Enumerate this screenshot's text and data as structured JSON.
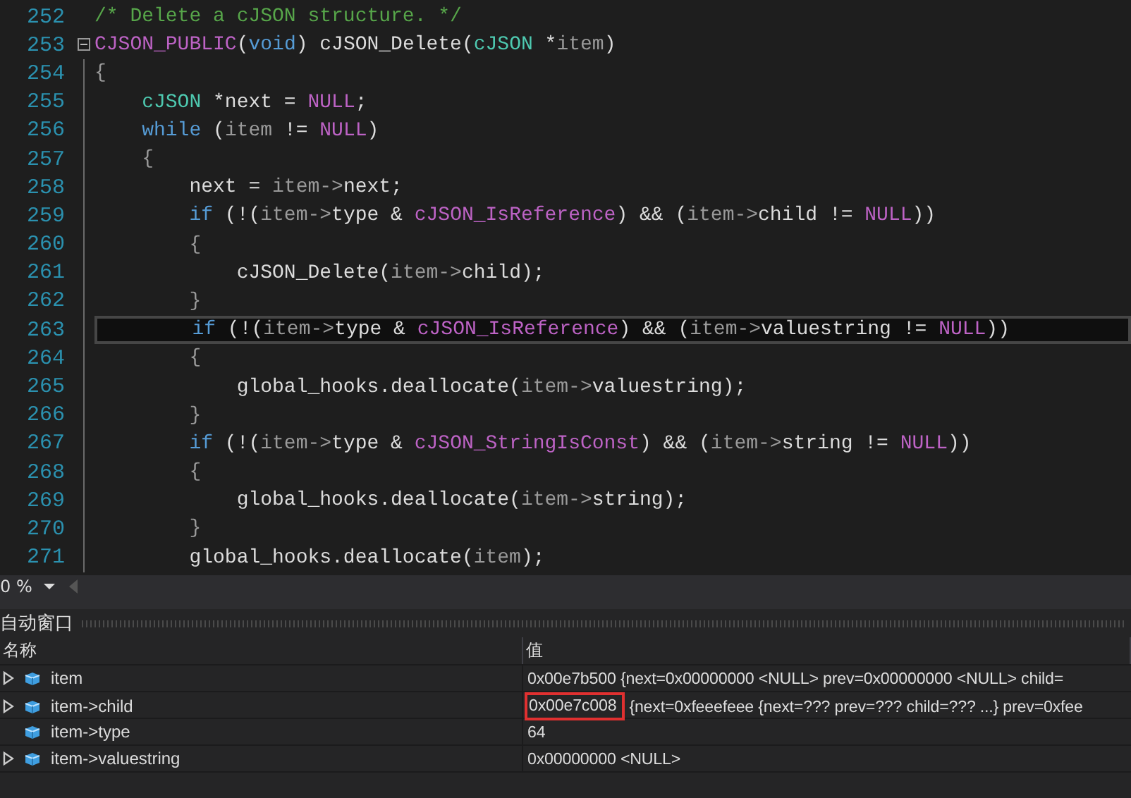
{
  "editor": {
    "lines": [
      {
        "number": "252",
        "current": false,
        "fold": false,
        "tokens": [
          {
            "kind": "comment",
            "text": "/* Delete a cJSON structure. */"
          }
        ]
      },
      {
        "number": "253",
        "current": false,
        "fold": true,
        "tokens": [
          {
            "kind": "macro",
            "text": "CJSON_PUBLIC"
          },
          {
            "kind": "plain",
            "text": "("
          },
          {
            "kind": "keyword",
            "text": "void"
          },
          {
            "kind": "plain",
            "text": ") cJSON_Delete("
          },
          {
            "kind": "type",
            "text": "cJSON"
          },
          {
            "kind": "plain",
            "text": " *"
          },
          {
            "kind": "param",
            "text": "item"
          },
          {
            "kind": "plain",
            "text": ")"
          }
        ]
      },
      {
        "number": "254",
        "current": false,
        "fold": false,
        "tokens": [
          {
            "kind": "punct",
            "text": "{"
          }
        ]
      },
      {
        "number": "255",
        "current": false,
        "fold": false,
        "tokens": [
          {
            "kind": "type",
            "text": "    cJSON"
          },
          {
            "kind": "plain",
            "text": " *next = "
          },
          {
            "kind": "macro",
            "text": "NULL"
          },
          {
            "kind": "plain",
            "text": ";"
          }
        ]
      },
      {
        "number": "256",
        "current": false,
        "fold": false,
        "tokens": [
          {
            "kind": "keyword",
            "text": "    while"
          },
          {
            "kind": "plain",
            "text": " ("
          },
          {
            "kind": "param",
            "text": "item"
          },
          {
            "kind": "plain",
            "text": " != "
          },
          {
            "kind": "macro",
            "text": "NULL"
          },
          {
            "kind": "plain",
            "text": ")"
          }
        ]
      },
      {
        "number": "257",
        "current": false,
        "fold": false,
        "tokens": [
          {
            "kind": "punct",
            "text": "    {"
          }
        ]
      },
      {
        "number": "258",
        "current": false,
        "fold": false,
        "tokens": [
          {
            "kind": "plain",
            "text": "        next = "
          },
          {
            "kind": "param",
            "text": "item->"
          },
          {
            "kind": "plain",
            "text": "next;"
          }
        ]
      },
      {
        "number": "259",
        "current": false,
        "fold": false,
        "tokens": [
          {
            "kind": "keyword",
            "text": "        if"
          },
          {
            "kind": "plain",
            "text": " (!("
          },
          {
            "kind": "param",
            "text": "item->"
          },
          {
            "kind": "plain",
            "text": "type & "
          },
          {
            "kind": "macro",
            "text": "cJSON_IsReference"
          },
          {
            "kind": "plain",
            "text": ") && ("
          },
          {
            "kind": "param",
            "text": "item->"
          },
          {
            "kind": "plain",
            "text": "child != "
          },
          {
            "kind": "macro",
            "text": "NULL"
          },
          {
            "kind": "plain",
            "text": "))"
          }
        ]
      },
      {
        "number": "260",
        "current": false,
        "fold": false,
        "tokens": [
          {
            "kind": "punct",
            "text": "        {"
          }
        ]
      },
      {
        "number": "261",
        "current": false,
        "fold": false,
        "tokens": [
          {
            "kind": "plain",
            "text": "            cJSON_Delete("
          },
          {
            "kind": "param",
            "text": "item->"
          },
          {
            "kind": "plain",
            "text": "child);"
          }
        ]
      },
      {
        "number": "262",
        "current": false,
        "fold": false,
        "tokens": [
          {
            "kind": "punct",
            "text": "        }"
          }
        ]
      },
      {
        "number": "263",
        "current": true,
        "fold": false,
        "tokens": [
          {
            "kind": "keyword",
            "text": "        if"
          },
          {
            "kind": "plain",
            "text": " (!("
          },
          {
            "kind": "param",
            "text": "item->"
          },
          {
            "kind": "plain",
            "text": "type & "
          },
          {
            "kind": "macro",
            "text": "cJSON_IsReference"
          },
          {
            "kind": "plain",
            "text": ") && ("
          },
          {
            "kind": "param",
            "text": "item->"
          },
          {
            "kind": "plain",
            "text": "valuestring != "
          },
          {
            "kind": "macro",
            "text": "NULL"
          },
          {
            "kind": "plain",
            "text": "))"
          }
        ]
      },
      {
        "number": "264",
        "current": false,
        "fold": false,
        "tokens": [
          {
            "kind": "punct",
            "text": "        {"
          }
        ]
      },
      {
        "number": "265",
        "current": false,
        "fold": false,
        "tokens": [
          {
            "kind": "plain",
            "text": "            global_hooks.deallocate("
          },
          {
            "kind": "param",
            "text": "item->"
          },
          {
            "kind": "plain",
            "text": "valuestring);"
          }
        ]
      },
      {
        "number": "266",
        "current": false,
        "fold": false,
        "tokens": [
          {
            "kind": "punct",
            "text": "        }"
          }
        ]
      },
      {
        "number": "267",
        "current": false,
        "fold": false,
        "tokens": [
          {
            "kind": "keyword",
            "text": "        if"
          },
          {
            "kind": "plain",
            "text": " (!("
          },
          {
            "kind": "param",
            "text": "item->"
          },
          {
            "kind": "plain",
            "text": "type & "
          },
          {
            "kind": "macro",
            "text": "cJSON_StringIsConst"
          },
          {
            "kind": "plain",
            "text": ") && ("
          },
          {
            "kind": "param",
            "text": "item->"
          },
          {
            "kind": "plain",
            "text": "string != "
          },
          {
            "kind": "macro",
            "text": "NULL"
          },
          {
            "kind": "plain",
            "text": "))"
          }
        ]
      },
      {
        "number": "268",
        "current": false,
        "fold": false,
        "tokens": [
          {
            "kind": "punct",
            "text": "        {"
          }
        ]
      },
      {
        "number": "269",
        "current": false,
        "fold": false,
        "tokens": [
          {
            "kind": "plain",
            "text": "            global_hooks.deallocate("
          },
          {
            "kind": "param",
            "text": "item->"
          },
          {
            "kind": "plain",
            "text": "string);"
          }
        ]
      },
      {
        "number": "270",
        "current": false,
        "fold": false,
        "tokens": [
          {
            "kind": "punct",
            "text": "        }"
          }
        ]
      },
      {
        "number": "271",
        "current": false,
        "fold": false,
        "tokens": [
          {
            "kind": "plain",
            "text": "        global_hooks.deallocate("
          },
          {
            "kind": "param",
            "text": "item"
          },
          {
            "kind": "plain",
            "text": ");"
          }
        ]
      }
    ],
    "zoom": "0 %"
  },
  "autos_window": {
    "title": "自动窗口",
    "columns": [
      "名称",
      "值"
    ],
    "rows": [
      {
        "name": "item",
        "expandable": true,
        "value": "0x00e7b500 {next=0x00000000 <NULL> prev=0x00000000 <NULL> child="
      },
      {
        "name": "item->child",
        "expandable": true,
        "value_boxed": "0x00e7c008",
        "value": "{next=0xfeeefeee {next=??? prev=??? child=??? ...} prev=0xfee"
      },
      {
        "name": "item->type",
        "expandable": false,
        "value": "64"
      },
      {
        "name": "item->valuestring",
        "expandable": true,
        "value": "0x00000000 <NULL>"
      }
    ]
  }
}
